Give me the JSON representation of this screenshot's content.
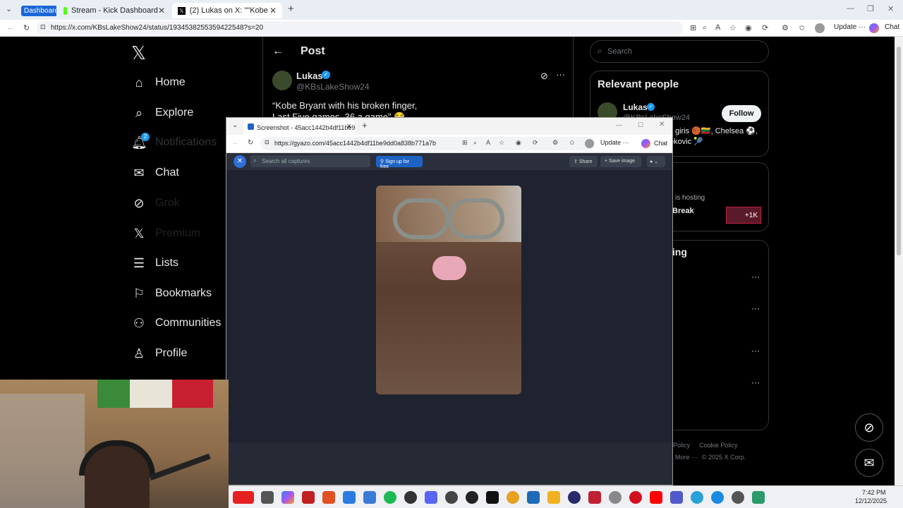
{
  "browser": {
    "tabs": [
      {
        "label": "Dashboard"
      },
      {
        "label": "Stream - Kick Dashboard"
      },
      {
        "label": "(2) Lukas on X: \"\"Kobe Bryant with"
      }
    ],
    "url": "https://x.com/KBsLakeShow24/status/1934538255359422548?s=20",
    "update_label": "Update",
    "chat_label": "Chat"
  },
  "x": {
    "nav": [
      {
        "label": "Home",
        "icon": "home-icon"
      },
      {
        "label": "Explore",
        "icon": "search-icon"
      },
      {
        "label": "Notifications",
        "icon": "bell-icon",
        "badge": "2"
      },
      {
        "label": "Chat",
        "icon": "mail-icon"
      },
      {
        "label": "Grok",
        "icon": "grok-icon"
      },
      {
        "label": "Premium",
        "icon": "x-icon"
      },
      {
        "label": "Lists",
        "icon": "list-icon"
      },
      {
        "label": "Bookmarks",
        "icon": "bookmark-icon"
      },
      {
        "label": "Communities",
        "icon": "people-icon"
      },
      {
        "label": "Profile",
        "icon": "person-icon"
      }
    ],
    "header_title": "Post",
    "post": {
      "name": "Lukas",
      "handle": "@KBsLakeShow24",
      "text_line1": "“Kobe Bryant with his broken finger,",
      "text_line2": "Last Five games, 36 a game” 😂"
    },
    "search_placeholder": "Search",
    "relevant_title": "Relevant people",
    "relevant_name": "Lukas",
    "relevant_handle": "@KBsLakeShow24",
    "follow_label": "Follow",
    "bio_partial": "giris 🏀🇱🇹, Chelsea ⚽,",
    "bio_partial2": "okovic 🎾",
    "space_hosting": "is hosting",
    "space_title": "Break",
    "space_count": "+1K",
    "trending_partial": "ling",
    "footer_links": [
      "Policy",
      "Cookie Policy"
    ],
    "footer_more": "More ···",
    "footer_copy": "© 2025 X Corp."
  },
  "popup": {
    "tab_title": "Screenshot - 45acc1442b4df11be9",
    "url": "https://gyazo.com/45acc1442b4df11be9dd0a838b771a7b",
    "update_label": "Update",
    "chat_label": "Chat",
    "search_placeholder": "Search all captures",
    "signup_label": "Sign up for free",
    "share_label": "Share",
    "save_label": "Save image"
  },
  "clock": {
    "time": "7:42 PM",
    "date": "12/12/2025"
  }
}
